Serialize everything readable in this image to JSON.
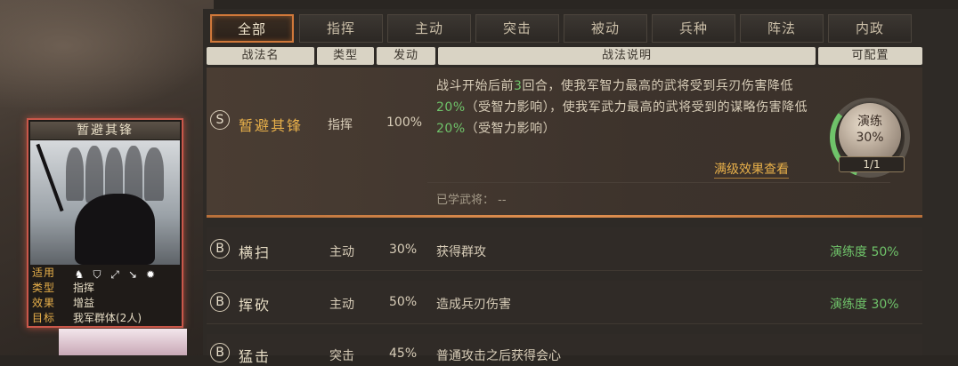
{
  "tabs": [
    "全部",
    "指挥",
    "主动",
    "突击",
    "被动",
    "兵种",
    "阵法",
    "内政"
  ],
  "active_tab": "全部",
  "header": {
    "name": "战法名",
    "type": "类型",
    "rate": "发动",
    "desc": "战法说明",
    "configurable": "可配置"
  },
  "selected": {
    "grade": "S",
    "name": "暂避其锋",
    "type": "指挥",
    "rate": "100%",
    "desc_parts": [
      {
        "t": "战斗开始后前"
      },
      {
        "t": "3",
        "g": true
      },
      {
        "t": "回合，使我军智力最高的武将受到兵刃伤害降低"
      },
      {
        "t": "20%",
        "g": true
      },
      {
        "t": "（受智力影响），使我军武力最高的武将受到的谋略伤害降低"
      },
      {
        "t": "20%",
        "g": true
      },
      {
        "t": "（受智力影响）"
      }
    ],
    "link": "满级效果查看",
    "learned_label": "已学武将：",
    "learned_value": "--",
    "practice_label": "演练",
    "practice_value": "30%",
    "practice_fraction": 0.3,
    "count": "1/1"
  },
  "rows": [
    {
      "grade": "B",
      "name": "横扫",
      "type": "主动",
      "rate": "30%",
      "desc": "获得群攻",
      "prof": "演练度 50%"
    },
    {
      "grade": "B",
      "name": "挥砍",
      "type": "主动",
      "rate": "50%",
      "desc": "造成兵刃伤害",
      "prof": "演练度 30%"
    },
    {
      "grade": "B",
      "name": "猛击",
      "type": "突击",
      "rate": "45%",
      "desc": "普通攻击之后获得会心",
      "prof": ""
    }
  ],
  "card": {
    "title": "暂避其锋",
    "fit_label": "适用",
    "fit_icons": [
      "cavalry-icon",
      "shield-icon",
      "bow-icon",
      "spear-icon",
      "siege-icon"
    ],
    "type_label": "类型",
    "type_value": "指挥",
    "effect_label": "效果",
    "effect_value": "增益",
    "target_label": "目标",
    "target_value": "我军群体(2人)"
  },
  "colors": {
    "accent": "#e8b04a",
    "green": "#6fc36a",
    "active_tab_border": "#d0783a",
    "card_border": "#c9574a"
  }
}
